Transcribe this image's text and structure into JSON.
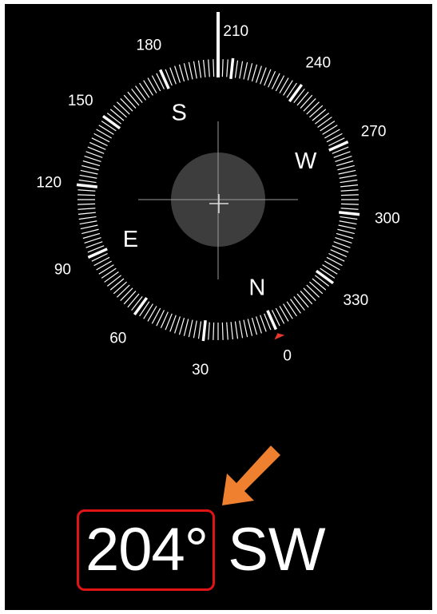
{
  "compass": {
    "heading_degrees": 204,
    "ring_labels": [
      {
        "text": "0",
        "deg": 0
      },
      {
        "text": "30",
        "deg": 30
      },
      {
        "text": "60",
        "deg": 60
      },
      {
        "text": "90",
        "deg": 90
      },
      {
        "text": "120",
        "deg": 120
      },
      {
        "text": "150",
        "deg": 150
      },
      {
        "text": "180",
        "deg": 180
      },
      {
        "text": "210",
        "deg": 210
      },
      {
        "text": "240",
        "deg": 240
      },
      {
        "text": "270",
        "deg": 270
      },
      {
        "text": "300",
        "deg": 300
      },
      {
        "text": "330",
        "deg": 330
      }
    ],
    "cardinals": [
      {
        "text": "N",
        "deg": 0
      },
      {
        "text": "E",
        "deg": 90
      },
      {
        "text": "S",
        "deg": 180
      },
      {
        "text": "W",
        "deg": 270
      }
    ]
  },
  "reading": {
    "degrees": "204°",
    "direction": "SW"
  },
  "colors": {
    "background": "#000000",
    "ticks": "#ffffff",
    "north_marker": "#e8372c",
    "annotation_arrow": "#ef8030",
    "highlight_box": "#e01414"
  },
  "icons": {
    "north_marker": "red-triangle-icon",
    "annotation": "orange-arrow-icon",
    "center": "crosshair-icon"
  }
}
